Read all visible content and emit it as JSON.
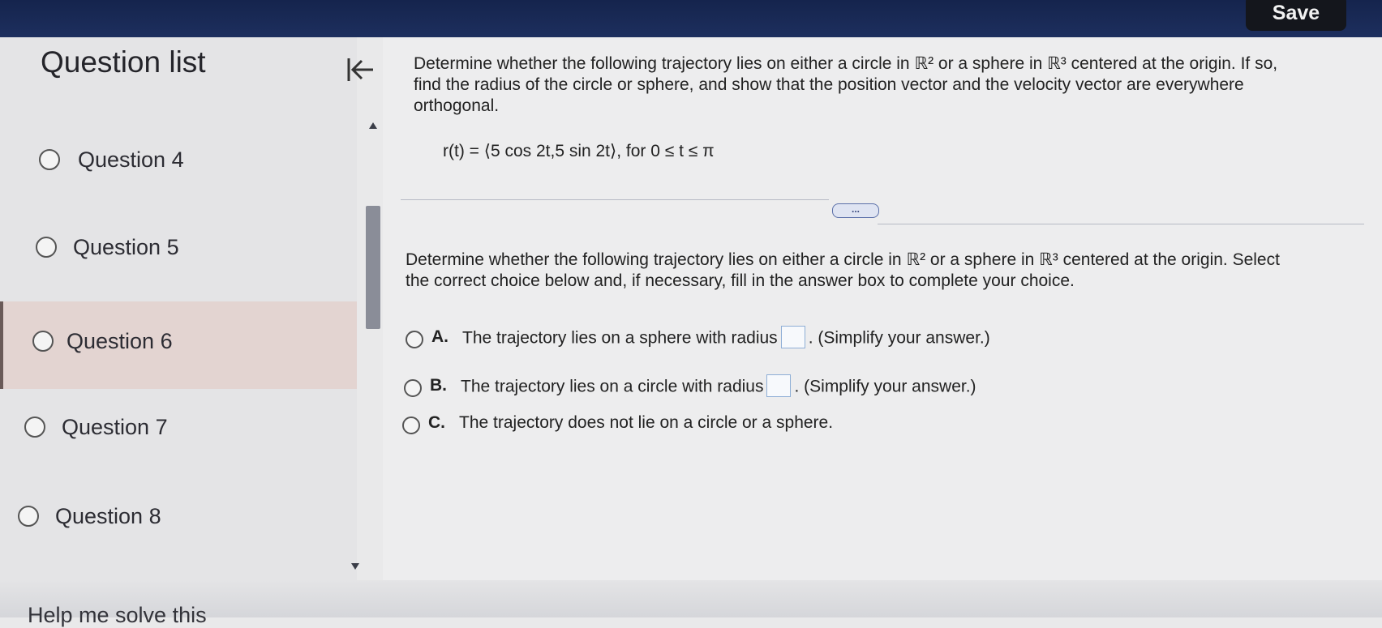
{
  "header": {
    "save_label": "Save"
  },
  "sidebar": {
    "title": "Question list",
    "items": [
      {
        "label": "Question 4"
      },
      {
        "label": "Question 5"
      },
      {
        "label": "Question 6"
      },
      {
        "label": "Question 7"
      },
      {
        "label": "Question 8"
      }
    ],
    "footer_partial": "Help me solve this"
  },
  "question1": {
    "prompt_line1": "Determine whether the following trajectory lies on either a circle in ℝ² or a sphere in ℝ³ centered at the origin. If so,",
    "prompt_line2": "find the radius of the circle or sphere, and show that the position vector and the velocity vector are everywhere",
    "prompt_line3": "orthogonal.",
    "formula": "r(t) = ⟨5 cos 2t,5 sin 2t⟩, for 0 ≤ t ≤ π"
  },
  "more_button": "...",
  "question2": {
    "prompt_line1": "Determine whether the following trajectory lies on either a circle in ℝ² or a sphere in ℝ³ centered at the origin. Select",
    "prompt_line2": "the correct choice below and, if necessary, fill in the answer box to complete your choice.",
    "choices": [
      {
        "letter": "A.",
        "before": "The trajectory lies on a sphere with radius",
        "after": ". (Simplify your answer.)"
      },
      {
        "letter": "B.",
        "before": "The trajectory lies on a circle with radius",
        "after": ". (Simplify your answer.)"
      },
      {
        "letter": "C.",
        "before": "The trajectory does not lie on a circle or a sphere.",
        "after": ""
      }
    ]
  }
}
